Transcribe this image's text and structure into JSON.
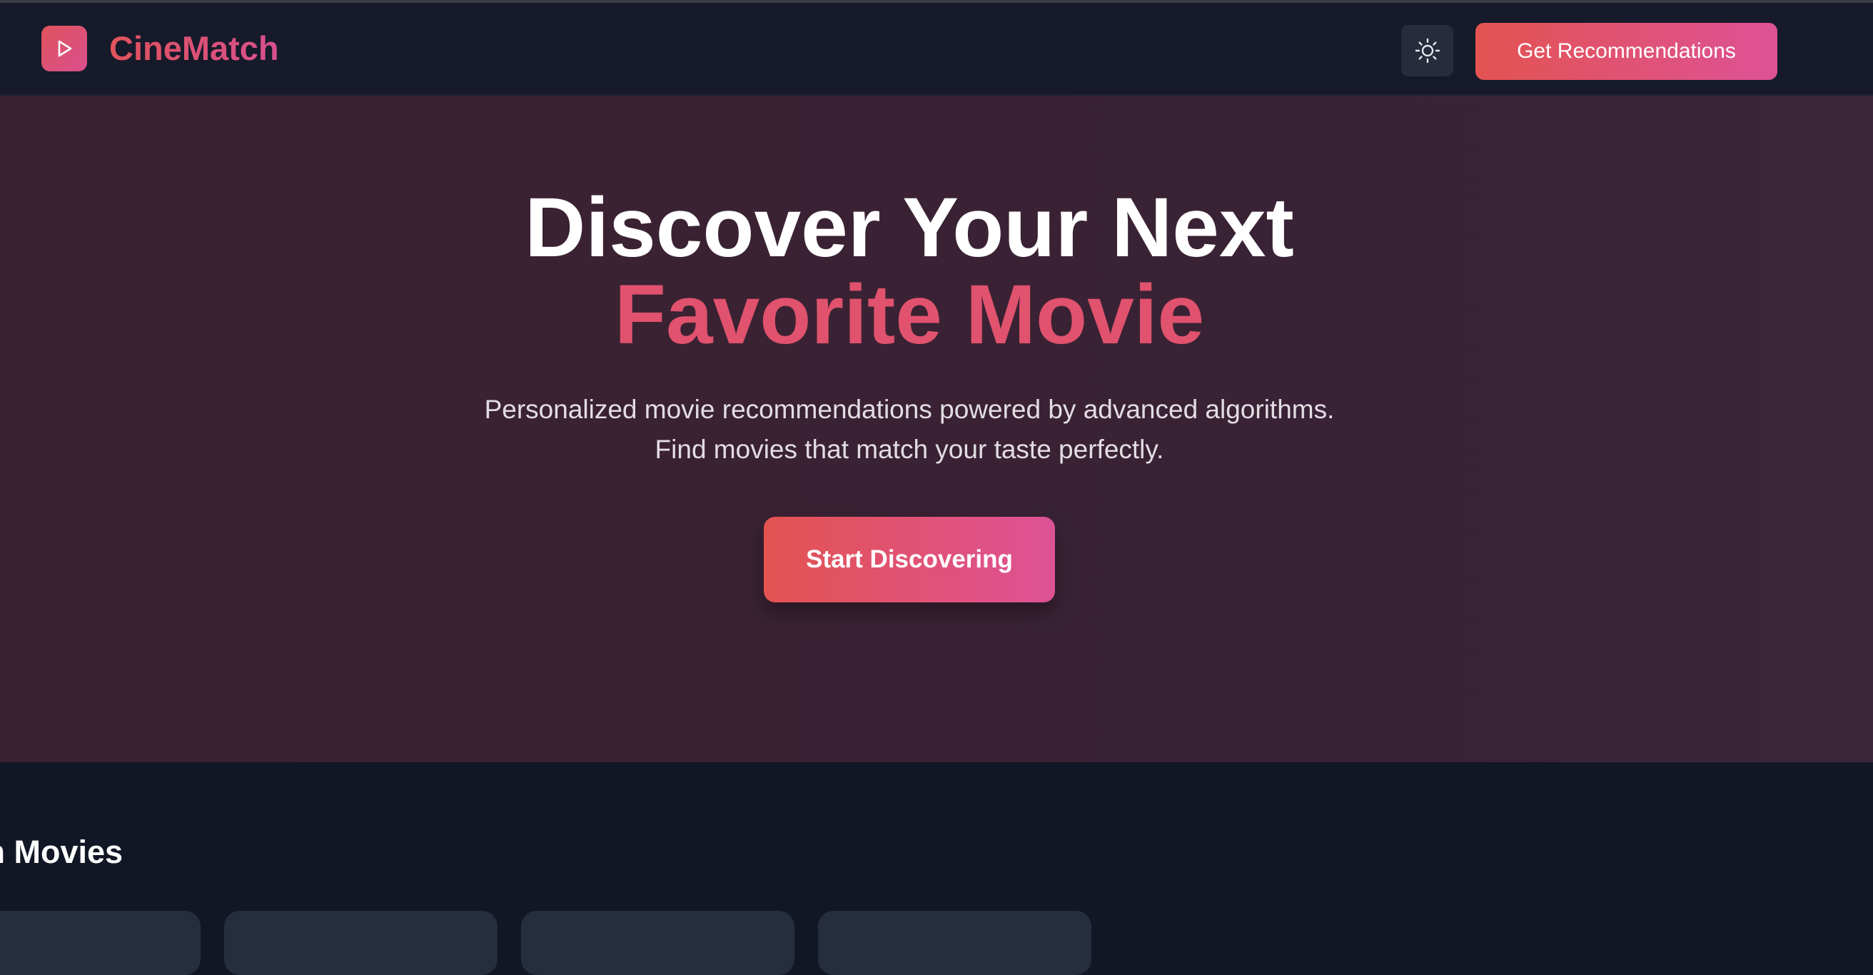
{
  "header": {
    "brand": "CineMatch",
    "theme_toggle_icon": "sun-icon",
    "cta_label": "Get Recommendations"
  },
  "hero": {
    "title_line1": "Discover Your Next",
    "title_line2": "Favorite Movie",
    "subtitle_line1": "Personalized movie recommendations powered by advanced algorithms.",
    "subtitle_line2": "Find movies that match your taste perfectly.",
    "button_label": "Start Discovering"
  },
  "section": {
    "title": "on Movies"
  },
  "colors": {
    "accent_start": "#e35351",
    "accent_end": "#dd5296",
    "background": "#121726",
    "header_bg": "#161a2a",
    "hero_bg": "#3a2234"
  }
}
